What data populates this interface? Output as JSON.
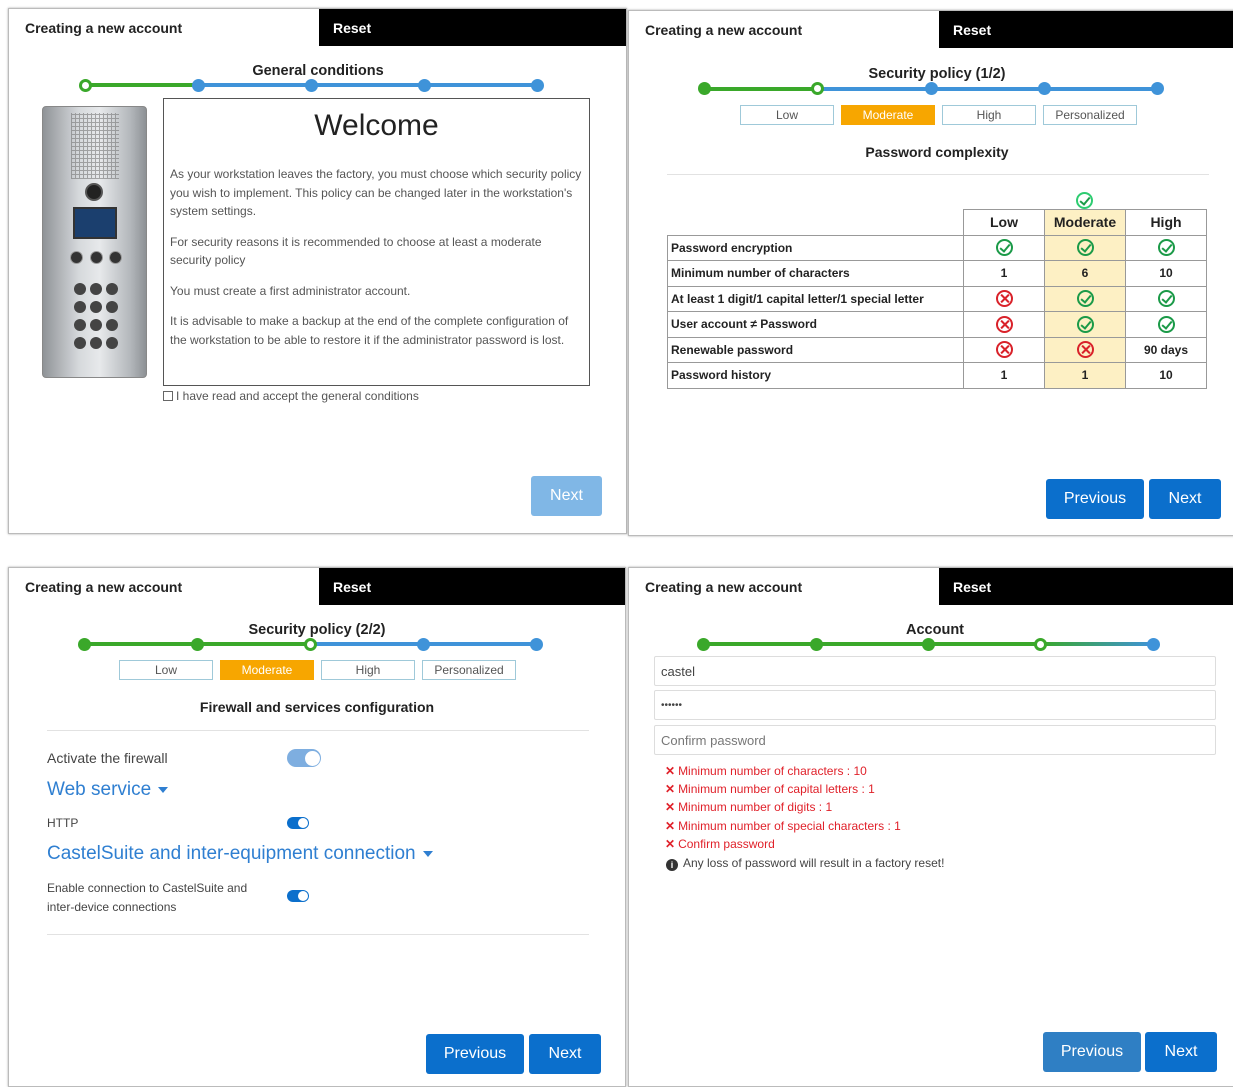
{
  "header": {
    "title": "Creating a new account",
    "reset": "Reset"
  },
  "tabs": [
    "Low",
    "Moderate",
    "High",
    "Personalized"
  ],
  "selected_tab": "Moderate",
  "panel1": {
    "step_label": "General conditions",
    "welcome_title": "Welcome",
    "paragraphs": [
      "As your workstation leaves the factory, you must choose which security policy you wish to implement. This policy can be changed later in the workstation's system settings.",
      "For security reasons it is recommended to choose at least a moderate security policy",
      "You must create a first administrator account.",
      "It is advisable to make a backup at the end of the complete configuration of the workstation to be able to restore it if the administrator password is lost."
    ],
    "accept_label": "I have read and accept the general conditions",
    "accept_checked": false,
    "next": "Next"
  },
  "panel2": {
    "step_label": "Security policy (1/2)",
    "subtitle": "Password complexity",
    "columns": [
      "Low",
      "Moderate",
      "High"
    ],
    "rows": [
      {
        "label": "Password encryption",
        "values": [
          "ok",
          "ok",
          "ok"
        ]
      },
      {
        "label": "Minimum number of characters",
        "values": [
          "1",
          "6",
          "10"
        ]
      },
      {
        "label": "At least 1 digit/1 capital letter/1 special letter",
        "values": [
          "no",
          "ok",
          "ok"
        ]
      },
      {
        "label": "User account ≠ Password",
        "values": [
          "no",
          "ok",
          "ok"
        ]
      },
      {
        "label": "Renewable password",
        "values": [
          "no",
          "no",
          "90 days"
        ]
      },
      {
        "label": "Password history",
        "values": [
          "1",
          "1",
          "10"
        ]
      }
    ],
    "previous": "Previous",
    "next": "Next"
  },
  "panel3": {
    "step_label": "Security policy (2/2)",
    "subtitle": "Firewall and services configuration",
    "firewall_label": "Activate the firewall",
    "section1": "Web service",
    "http_label": "HTTP",
    "section2": "CastelSuite and inter-equipment connection",
    "conn_label_1": "Enable connection to CastelSuite and",
    "conn_label_2": "inter-device connections",
    "previous": "Previous",
    "next": "Next"
  },
  "panel4": {
    "step_label": "Account",
    "username_value": "castel",
    "password_value": "••••••",
    "confirm_placeholder": "Confirm password",
    "errors": [
      "Minimum number of characters : 10",
      "Minimum number of capital letters : 1",
      "Minimum number of digits : 1",
      "Minimum number of special characters : 1",
      "Confirm password"
    ],
    "info": "Any loss of password will result in a factory reset!",
    "previous": "Previous",
    "next": "Next"
  },
  "colors": {
    "accent": "#0b6fcc",
    "step_done": "#3aa82a",
    "step_todo": "#3f93d9",
    "tab_selected": "#f7a600",
    "error": "#e0212a"
  }
}
